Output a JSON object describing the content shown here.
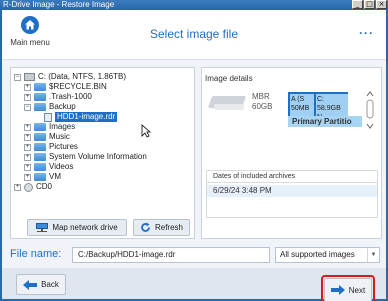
{
  "window": {
    "title": "R-Drive Image - Restore Image",
    "controls": [
      "_",
      "□",
      "×"
    ]
  },
  "header": {
    "menu_label": "Main menu",
    "title": "Select image file",
    "more": "···"
  },
  "tree": {
    "root": "C: (Data, NTFS, 1.86TB)",
    "items": [
      "$RECYCLE.BIN",
      ".Trash-1000",
      "Backup",
      "HDD1-image.rdr",
      "Images",
      "Music",
      "Pictures",
      "System Volume Information",
      "Videos",
      "VM"
    ],
    "second_drive": "CD0"
  },
  "buttons": {
    "map_network": "Map network drive",
    "refresh": "Refresh",
    "back": "Back",
    "next": "Next"
  },
  "details": {
    "title": "Image details",
    "disk_type": "MBR",
    "disk_size": "60GB",
    "part1_name": "A (S",
    "part1_size": "50MB",
    "part2_name": "C:",
    "part2_size": "58.9GB N",
    "primary_label": "Primary Partitio",
    "archives_header": "Dates of included archives",
    "archives": [
      "6/29/24 3:48 PM"
    ]
  },
  "filename": {
    "label": "File name:",
    "value": "C:/Backup/HDD1-image.rdr",
    "filter": "All supported images"
  },
  "colors": {
    "accent": "#1e6fc7",
    "highlight": "#d41e1e"
  }
}
